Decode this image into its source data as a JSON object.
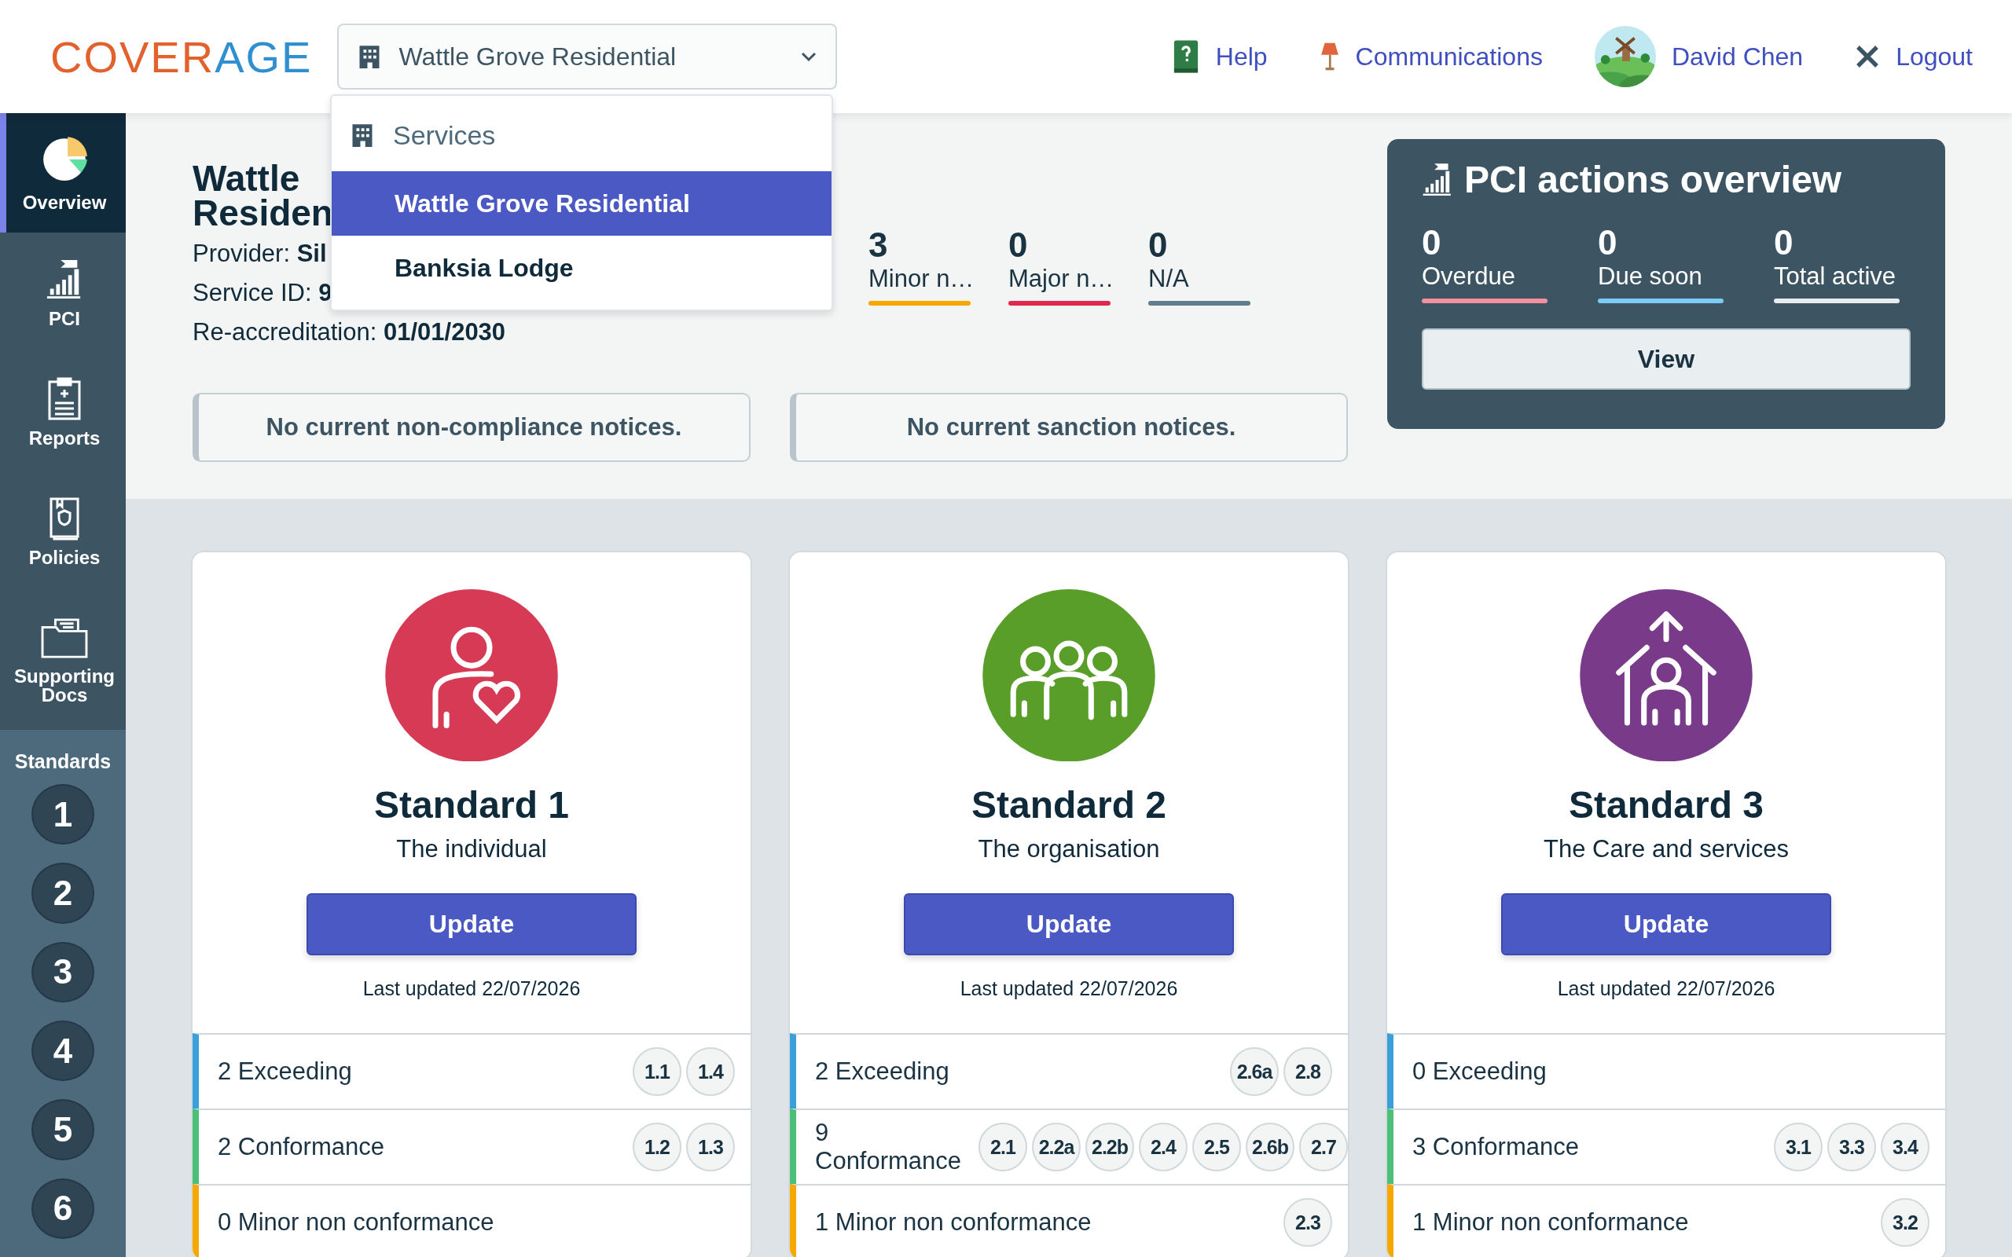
{
  "logo": {
    "first": "COVER",
    "second": "AGE"
  },
  "service_select": {
    "value": "Wattle Grove Residential",
    "menu": {
      "heading": "Services",
      "options": [
        {
          "label": "Wattle Grove Residential",
          "selected": true
        },
        {
          "label": "Banksia Lodge",
          "selected": false
        }
      ]
    }
  },
  "header_links": [
    {
      "kind": "help",
      "label": "Help"
    },
    {
      "kind": "communications",
      "label": "Communications"
    },
    {
      "kind": "user",
      "label": "David Chen"
    },
    {
      "kind": "logout",
      "label": "Logout"
    }
  ],
  "sidebar": {
    "items": [
      {
        "kind": "overview",
        "label": "Overview",
        "selected": true
      },
      {
        "kind": "pci",
        "label": "PCI",
        "selected": false
      },
      {
        "kind": "reports",
        "label": "Reports",
        "selected": false
      },
      {
        "kind": "policies",
        "label": "Policies",
        "selected": false
      },
      {
        "kind": "docs",
        "label": "Supporting Docs",
        "selected": false
      }
    ],
    "standards_heading": "Standards",
    "standards": [
      "1",
      "2",
      "3",
      "4",
      "5",
      "6"
    ]
  },
  "service": {
    "title_lines": [
      "Wattle",
      "Residen"
    ],
    "details": [
      {
        "label": "Provider:",
        "value": "Sil"
      },
      {
        "label": "Service ID:",
        "value": "9"
      },
      {
        "label": "Re-accreditation:",
        "value": "01/01/2030"
      }
    ]
  },
  "notice_counts": [
    {
      "value": "3",
      "label": "Minor n…",
      "color": "#f6a800"
    },
    {
      "value": "0",
      "label": "Major n…",
      "color": "#e0284f"
    },
    {
      "value": "0",
      "label": "N/A",
      "color": "#5f7d8a"
    }
  ],
  "notices": [
    "No current non-compliance notices.",
    "No current sanction notices."
  ],
  "pci_overview": {
    "title": "PCI actions overview",
    "stats": [
      {
        "value": "0",
        "label": "Overdue",
        "color": "#f48fa0"
      },
      {
        "value": "0",
        "label": "Due soon",
        "color": "#7ccbf5"
      },
      {
        "value": "0",
        "label": "Total active",
        "color": "#e8ecee"
      }
    ],
    "button": "View"
  },
  "standards": [
    {
      "kind": "individual",
      "color": "#d63a55",
      "title": "Standard 1",
      "subtitle": "The individual",
      "button": "Update",
      "last_updated": "Last updated 22/07/2026",
      "rows": [
        {
          "kind": "exceeding",
          "label": "2 Exceeding",
          "chips": [
            "1.1",
            "1.4"
          ]
        },
        {
          "kind": "conformance",
          "label": "2 Conformance",
          "chips": [
            "1.2",
            "1.3"
          ]
        },
        {
          "kind": "minor",
          "label": "0 Minor non conformance",
          "chips": []
        }
      ]
    },
    {
      "kind": "organisation",
      "color": "#5a9e2a",
      "title": "Standard 2",
      "subtitle": "The organisation",
      "button": "Update",
      "last_updated": "Last updated 22/07/2026",
      "rows": [
        {
          "kind": "exceeding",
          "label": "2 Exceeding",
          "chips": [
            "2.6a",
            "2.8"
          ]
        },
        {
          "kind": "conformance",
          "label": "9 Conformance",
          "chips": [
            "2.1",
            "2.2a",
            "2.2b",
            "2.4",
            "2.5",
            "2.6b",
            "2.7"
          ]
        },
        {
          "kind": "minor",
          "label": "1 Minor non conformance",
          "chips": [
            "2.3"
          ]
        }
      ]
    },
    {
      "kind": "care",
      "color": "#7a3a8a",
      "title": "Standard 3",
      "subtitle": "The Care and services",
      "button": "Update",
      "last_updated": "Last updated 22/07/2026",
      "rows": [
        {
          "kind": "exceeding",
          "label": "0 Exceeding",
          "chips": []
        },
        {
          "kind": "conformance",
          "label": "3 Conformance",
          "chips": [
            "3.1",
            "3.3",
            "3.4"
          ]
        },
        {
          "kind": "minor",
          "label": "1 Minor non conformance",
          "chips": [
            "3.2"
          ]
        }
      ]
    }
  ]
}
